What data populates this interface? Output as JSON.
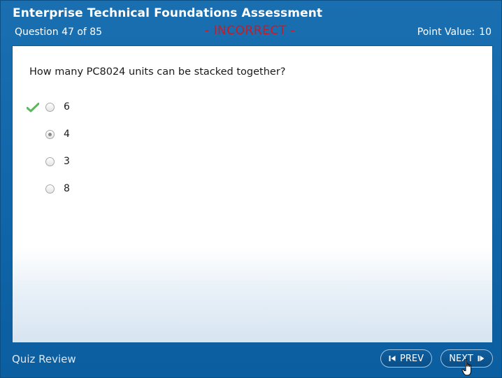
{
  "header": {
    "title": "Enterprise Technical Foundations Assessment",
    "question_counter": "Question 47 of 85",
    "status": "- INCORRECT -",
    "point_value_label": "Point Value:",
    "point_value": "10"
  },
  "question": {
    "text": "How many PC8024 units can be stacked together?",
    "answers": [
      {
        "label": "6",
        "correct": true,
        "selected": false
      },
      {
        "label": "4",
        "correct": false,
        "selected": true
      },
      {
        "label": "3",
        "correct": false,
        "selected": false
      },
      {
        "label": "8",
        "correct": false,
        "selected": false
      }
    ]
  },
  "footer": {
    "label": "Quiz Review",
    "prev_label": "PREV",
    "next_label": "NEXT"
  },
  "colors": {
    "header_blue": "#1a6fb0",
    "incorrect_red": "#d8151b",
    "correct_green": "#5cb85c"
  },
  "icons": {
    "correct_marker": "checkmark-icon",
    "prev": "prev-arrow-icon",
    "next": "next-arrow-icon",
    "pointer": "hand-cursor-icon"
  }
}
